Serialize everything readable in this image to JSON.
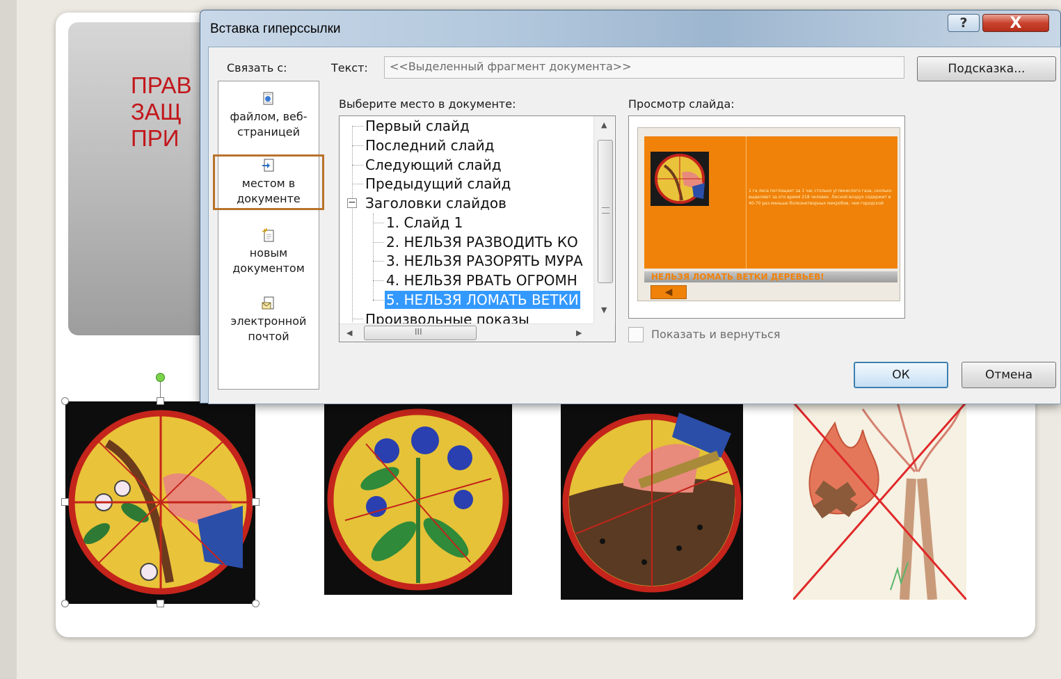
{
  "slide": {
    "title_lines": "ПРАВ\nЗАЩ\nПРИ"
  },
  "dialog": {
    "title": "Вставка гиперссылки",
    "help_glyph": "?",
    "close_glyph": "X",
    "link_with_label": "Связать с:",
    "link_options": [
      {
        "label": "файлом, веб-\nстраницей",
        "icon": "file-web-icon"
      },
      {
        "label": "местом в\nдокументе",
        "icon": "document-place-icon",
        "selected": true
      },
      {
        "label": "новым\nдокументом",
        "icon": "new-document-icon"
      },
      {
        "label": "электронной\nпочтой",
        "icon": "email-icon"
      }
    ],
    "text_label": "Текст:",
    "text_value": "<<Выделенный фрагмент документа>>",
    "hint_button": "Подсказка...",
    "place_label": "Выберите место в документе:",
    "tree": {
      "top_items": [
        "Первый слайд",
        "Последний слайд",
        "Следующий слайд",
        "Предыдущий слайд"
      ],
      "group": "Заголовки слайдов",
      "children": [
        "1. Слайд 1",
        "2. НЕЛЬЗЯ РАЗВОДИТЬ КО",
        "3. НЕЛЬЗЯ РАЗОРЯТЬ МУРА",
        "4. НЕЛЬЗЯ РВАТЬ ОГРОМН",
        "5. НЕЛЬЗЯ ЛОМАТЬ ВЕТКИ"
      ],
      "selected_index": 4,
      "last_item": "Произвольные показы",
      "hscroll_grip": "III"
    },
    "preview_label": "Просмотр слайда:",
    "preview": {
      "body_text": "1 га леса поглощает за 1 час столько углекислого газа, сколько выделяют за это время 218 человек. Лесной воздух содержит в 40-70 раз меньше болезнетворных микробов, чем городской",
      "band_text": "НЕЛЬЗЯ ЛОМАТЬ ВЕТКИ ДЕРЕВЬЕВ!"
    },
    "show_and_return_label": "Показать и вернуться",
    "show_and_return_checked": false,
    "ok_button": "ОК",
    "cancel_button": "Отмена"
  },
  "colors": {
    "title_red": "#c2161b",
    "selection_blue": "#3399ff",
    "selected_link_outline": "#b9722c",
    "preview_orange": "#f0820a"
  }
}
